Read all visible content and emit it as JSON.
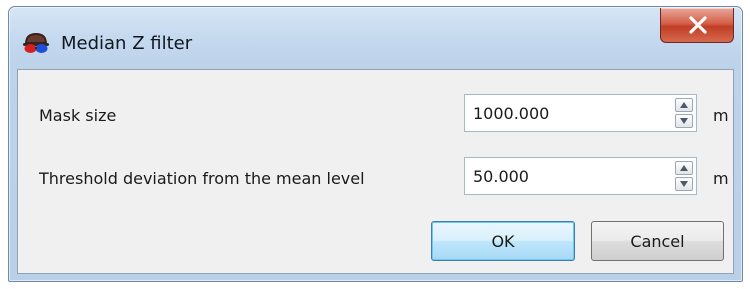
{
  "window": {
    "title": "Median Z filter",
    "close_glyph": "x",
    "icon": "3d-glasses-icon"
  },
  "fields": [
    {
      "label": "Mask size",
      "value": "1000.000",
      "unit": "m"
    },
    {
      "label": "Threshold deviation from the mean level",
      "value": "50.000",
      "unit": "m"
    }
  ],
  "buttons": {
    "ok": "OK",
    "cancel": "Cancel"
  },
  "colors": {
    "title_bar": "#c5d9ef",
    "close_button": "#c9472e",
    "client_bg": "#f0f0f0",
    "default_button_border": "#3c7fb1"
  }
}
